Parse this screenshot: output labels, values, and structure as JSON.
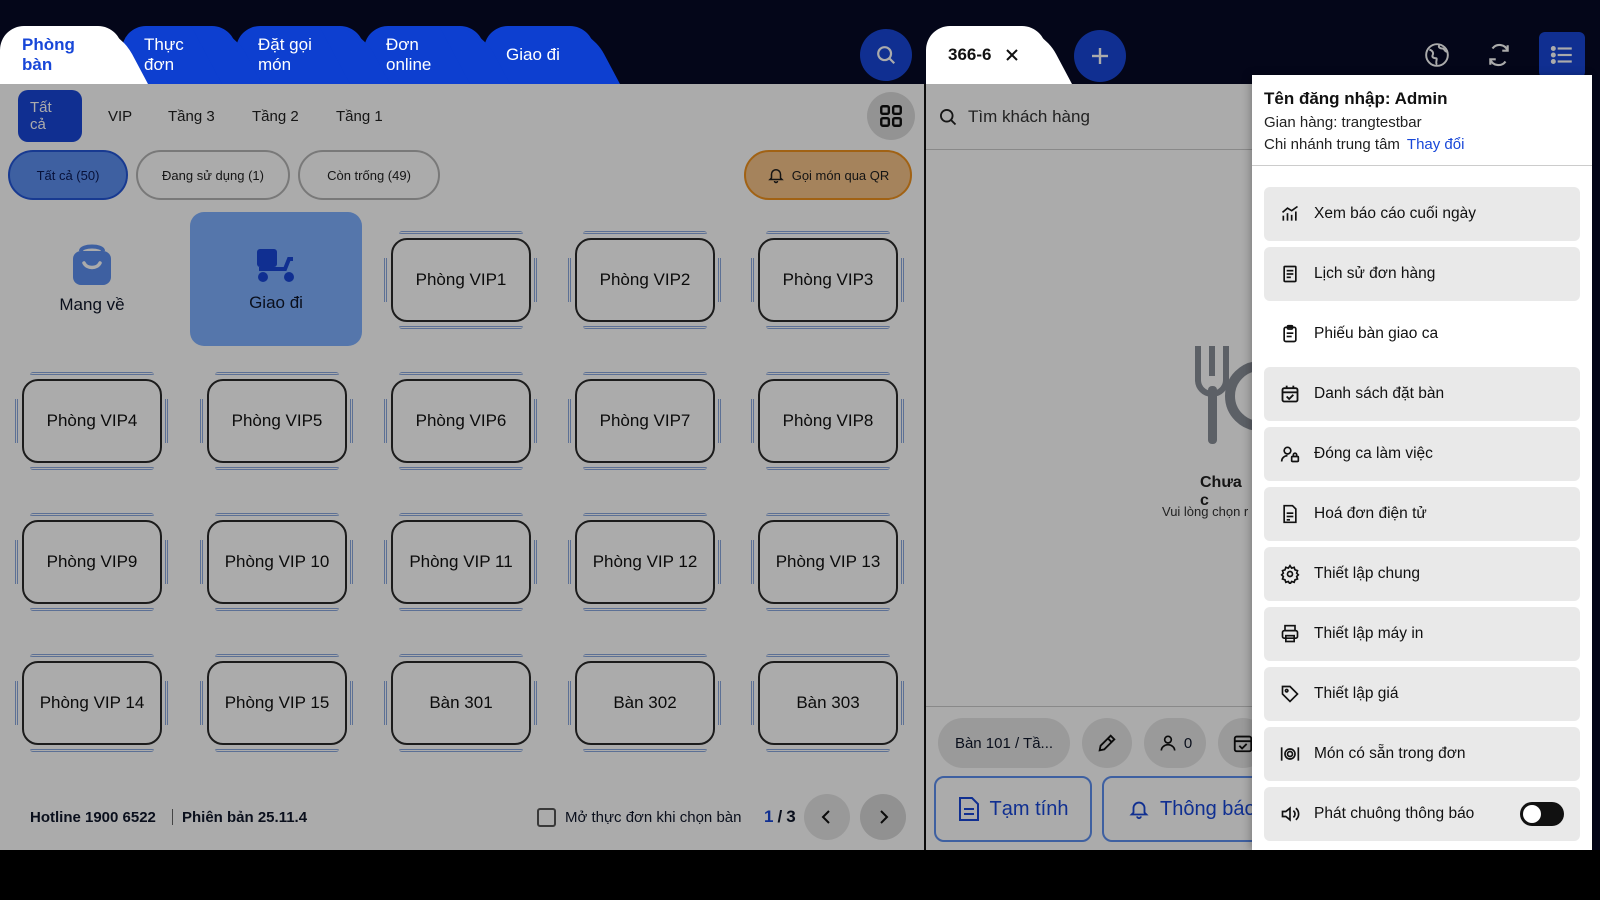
{
  "tabs": [
    "Phòng bàn",
    "Thực đơn",
    "Đặt gọi món",
    "Đơn online",
    "Giao đi"
  ],
  "order_tab": "366-6",
  "left": {
    "subtabs": [
      "Tất cả",
      "VIP",
      "Tầng 3",
      "Tầng 2",
      "Tầng 1"
    ],
    "filters": [
      "Tất cả (50)",
      "Đang sử dụng (1)",
      "Còn trống (49)"
    ],
    "qr_label": "Gọi món qua QR",
    "takeaway": "Mang về",
    "delivery": "Giao đi",
    "tables": [
      "Phòng VIP1",
      "Phòng VIP2",
      "Phòng VIP3",
      "Phòng VIP4",
      "Phòng VIP5",
      "Phòng VIP6",
      "Phòng VIP7",
      "Phòng VIP8",
      "Phòng VIP9",
      "Phòng VIP 10",
      "Phòng VIP 11",
      "Phòng VIP 12",
      "Phòng VIP 13",
      "Phòng VIP 14",
      "Phòng VIP 15",
      "Bàn 301",
      "Bàn 302",
      "Bàn 303"
    ],
    "hotline": "Hotline 1900 6522",
    "version": "Phiên bản 25.11.4",
    "open_menu_label": "Mở thực đơn khi chọn bàn",
    "page_current": "1",
    "page_sep": "/",
    "page_total": "3"
  },
  "middle": {
    "search_placeholder": "Tìm khách hàng",
    "empty_title": "Chưa c",
    "empty_sub": "Vui lòng chọn r",
    "table_chip": "Bàn 101 / Tầ...",
    "guests": "0",
    "temp_bill": "Tạm tính",
    "notify": "Thông báo"
  },
  "menu": {
    "login": "Tên đăng nhập: Admin",
    "store": "Gian hàng: trangtestbar",
    "branch": "Chi nhánh trung tâm",
    "change": "Thay đổi",
    "items": [
      {
        "label": "Xem báo cáo cuối ngày",
        "icon": "chart-icon"
      },
      {
        "label": "Lịch sử đơn hàng",
        "icon": "receipt-icon"
      },
      {
        "label": "Phiếu bàn giao ca",
        "icon": "clipboard-icon"
      },
      {
        "label": "Danh sách đặt bàn",
        "icon": "calendar-check-icon"
      },
      {
        "label": "Đóng ca làm việc",
        "icon": "user-lock-icon"
      },
      {
        "label": "Hoá đơn điện tử",
        "icon": "invoice-icon"
      },
      {
        "label": "Thiết lập chung",
        "icon": "gear-icon"
      },
      {
        "label": "Thiết lập máy in",
        "icon": "printer-icon"
      },
      {
        "label": "Thiết lập giá",
        "icon": "tag-icon"
      },
      {
        "label": "Món có sẵn trong đơn",
        "icon": "dish-icon"
      },
      {
        "label": "Phát chuông thông báo",
        "icon": "speaker-icon"
      }
    ]
  }
}
